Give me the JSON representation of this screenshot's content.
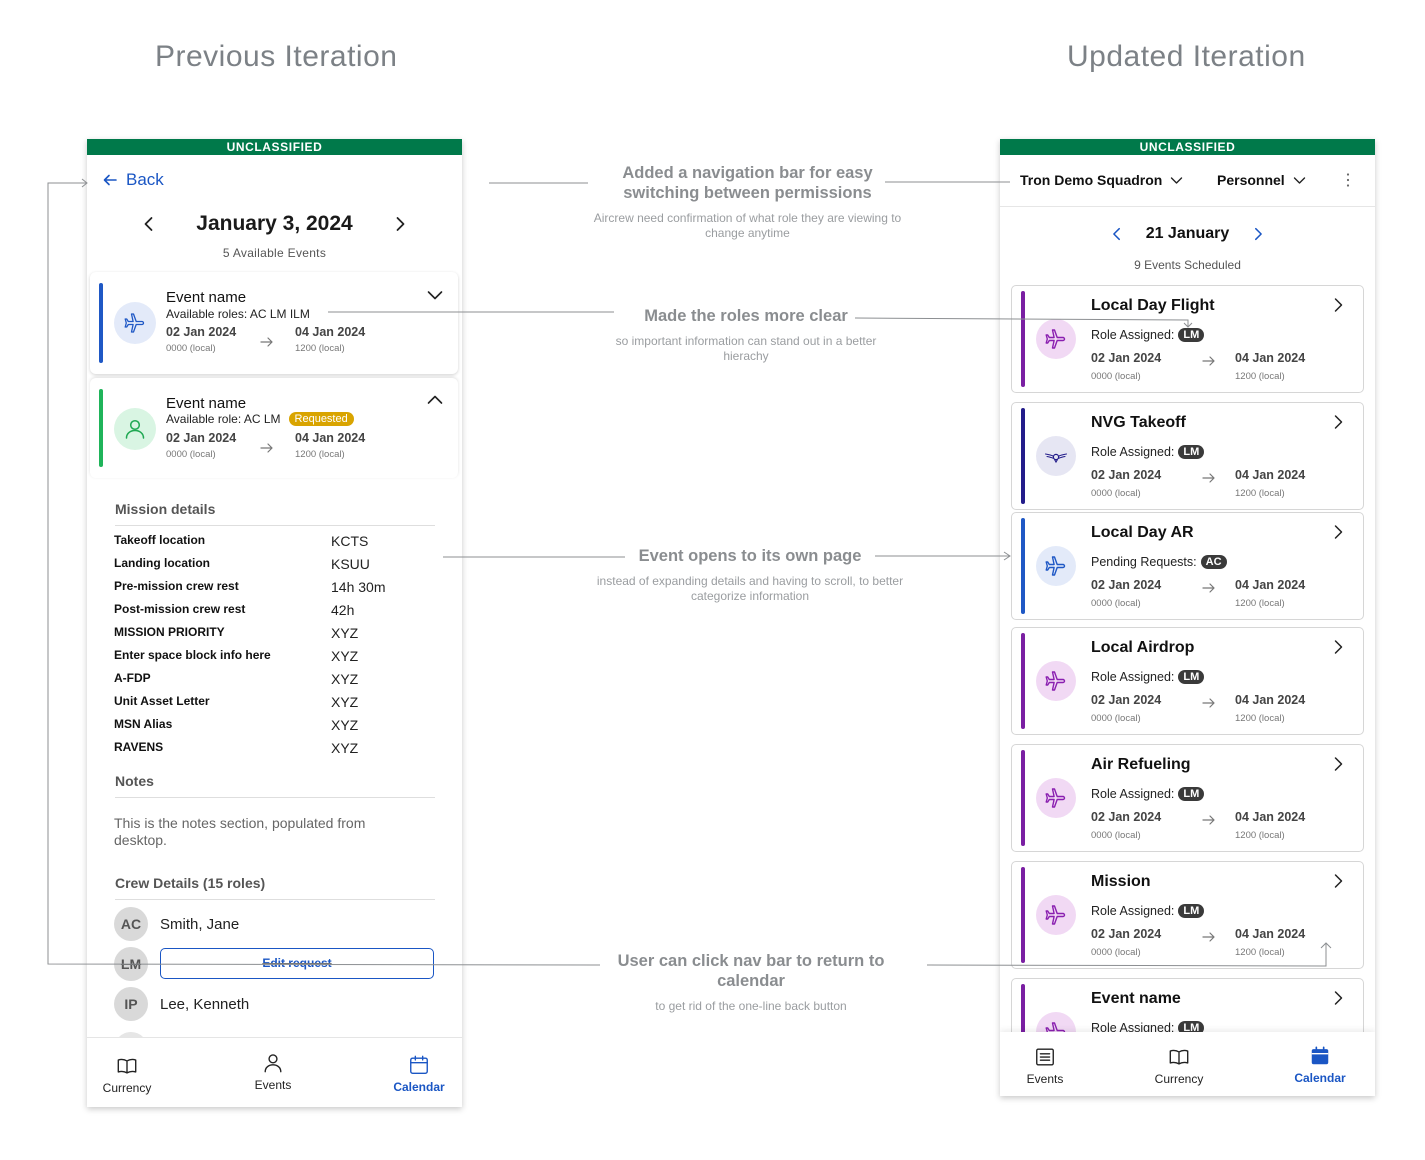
{
  "titles": {
    "previous": "Previous Iteration",
    "updated": "Updated Iteration"
  },
  "classification": "UNCLASSIFIED",
  "left": {
    "back_label": "Back",
    "date": "January 3, 2024",
    "count": "5 Available Events",
    "events": [
      {
        "name": "Event name",
        "roles": "Available roles: AC LM ILM",
        "start_date": "02 Jan 2024",
        "start_time": "0000 (local)",
        "end_date": "04 Jan 2024",
        "end_time": "1200 (local)",
        "color": "#1f58c5",
        "icon": "airplane-icon"
      },
      {
        "name": "Event name",
        "roles": "Available role: AC LM",
        "badge": "Requested",
        "start_date": "02 Jan 2024",
        "start_time": "0000 (local)",
        "end_date": "04 Jan 2024",
        "end_time": "1200 (local)",
        "color": "#1fb45a",
        "icon": "person-icon"
      }
    ],
    "mission_details_title": "Mission details",
    "mission_details": [
      {
        "key": "Takeoff location",
        "value": "KCTS"
      },
      {
        "key": "Landing location",
        "value": "KSUU"
      },
      {
        "key": "Pre-mission crew rest",
        "value": "14h 30m"
      },
      {
        "key": "Post-mission crew rest",
        "value": "42h"
      },
      {
        "key": "MISSION PRIORITY",
        "value": "XYZ"
      },
      {
        "key": "Enter space block info here",
        "value": "XYZ"
      },
      {
        "key": "A-FDP",
        "value": "XYZ"
      },
      {
        "key": "Unit Asset Letter",
        "value": "XYZ"
      },
      {
        "key": "MSN Alias",
        "value": "XYZ"
      },
      {
        "key": "RAVENS",
        "value": "XYZ"
      }
    ],
    "notes_title": "Notes",
    "notes_text": "This is the notes section, populated from desktop.",
    "crew_title": "Crew Details (15 roles)",
    "crew": [
      {
        "initials": "AC",
        "name": "Smith, Jane"
      },
      {
        "initials": "LM",
        "name": ""
      },
      {
        "initials": "IP",
        "name": "Lee, Kenneth"
      }
    ],
    "edit_request": "Edit request",
    "tabs": [
      {
        "label": "Currency",
        "icon": "book-icon"
      },
      {
        "label": "Events",
        "icon": "person-icon"
      },
      {
        "label": "Calendar",
        "icon": "calendar-icon",
        "active": true
      }
    ]
  },
  "right": {
    "squadron": "Tron Demo Squadron",
    "view": "Personnel",
    "date": "21 January",
    "count": "9 Events Scheduled",
    "events": [
      {
        "title": "Local Day Flight",
        "role_label": "Role Assigned:",
        "role": "LM",
        "start_date": "02 Jan 2024",
        "start_time": "0000 (local)",
        "end_date": "04 Jan 2024",
        "end_time": "1200 (local)",
        "color": "#7a1fa2",
        "icon": "airplane-icon"
      },
      {
        "title": "NVG Takeoff",
        "role_label": "Role Assigned:",
        "role": "LM",
        "start_date": "02 Jan 2024",
        "start_time": "0000 (local)",
        "end_date": "04 Jan 2024",
        "end_time": "1200 (local)",
        "color": "#231c8a",
        "icon": "wings-icon"
      },
      {
        "title": "Local Day AR",
        "role_label": "Pending Requests:",
        "role": "AC",
        "start_date": "02 Jan 2024",
        "start_time": "0000 (local)",
        "end_date": "04 Jan 2024",
        "end_time": "1200 (local)",
        "color": "#1f58c5",
        "icon": "airplane-icon"
      },
      {
        "title": "Local Airdrop",
        "role_label": "Role Assigned:",
        "role": "LM",
        "start_date": "02 Jan 2024",
        "start_time": "0000 (local)",
        "end_date": "04 Jan 2024",
        "end_time": "1200 (local)",
        "color": "#7a1fa2",
        "icon": "airplane-icon"
      },
      {
        "title": "Air Refueling",
        "role_label": "Role Assigned:",
        "role": "LM",
        "start_date": "02 Jan 2024",
        "start_time": "0000 (local)",
        "end_date": "04 Jan 2024",
        "end_time": "1200 (local)",
        "color": "#7a1fa2",
        "icon": "airplane-icon"
      },
      {
        "title": "Mission",
        "role_label": "Role Assigned:",
        "role": "LM",
        "start_date": "02 Jan 2024",
        "start_time": "0000 (local)",
        "end_date": "04 Jan 2024",
        "end_time": "1200 (local)",
        "color": "#7a1fa2",
        "icon": "airplane-icon"
      },
      {
        "title": "Event name",
        "role_label": "Role Assigned:",
        "role": "LM",
        "start_date": "",
        "start_time": "",
        "end_date": "",
        "end_time": "",
        "color": "#7a1fa2",
        "icon": "airplane-icon"
      }
    ],
    "tabs": [
      {
        "label": "Events",
        "icon": "list-icon"
      },
      {
        "label": "Currency",
        "icon": "book-icon"
      },
      {
        "label": "Calendar",
        "icon": "calendar-icon",
        "active": true
      }
    ]
  },
  "annotations": [
    {
      "heading": "Added a navigation bar for easy switching between permissions",
      "sub": "Aircrew need confirmation of what role they are viewing to change anytime"
    },
    {
      "heading": "Made the roles more clear",
      "sub": "so important information can stand out in a better hierachy"
    },
    {
      "heading": "Event opens to its own page",
      "sub": "instead of expanding details and having to scroll, to better categorize information"
    },
    {
      "heading": "User can click nav bar to return to calendar",
      "sub": "to get rid of the one-line back button"
    }
  ],
  "colors": {
    "classification": "#00794a",
    "accent": "#1a56c4",
    "requested": "#d9a400"
  }
}
